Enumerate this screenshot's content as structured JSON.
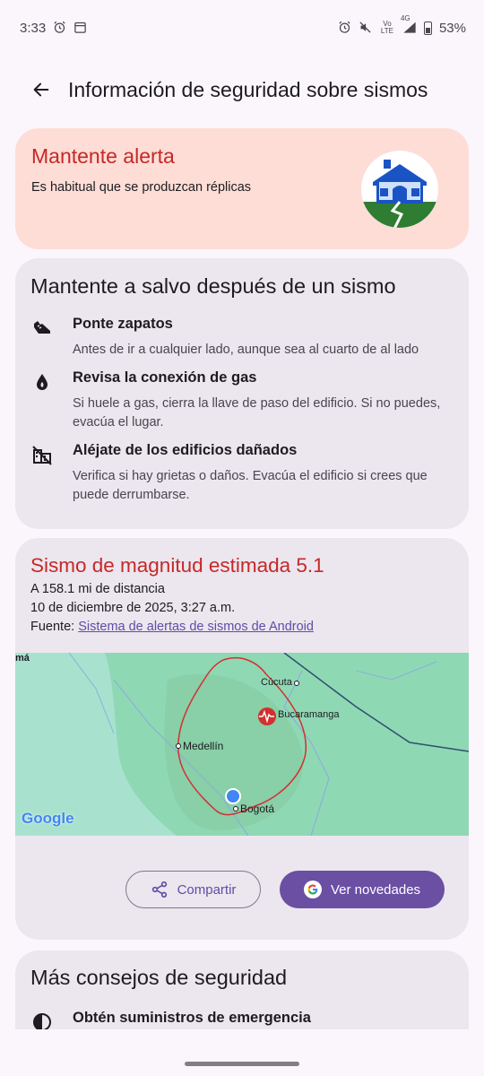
{
  "status_bar": {
    "time": "3:33",
    "network": "4G",
    "volte": "Vo LTE",
    "battery": "53%"
  },
  "app_bar": {
    "title": "Información de seguridad sobre sismos"
  },
  "alert_card": {
    "title": "Mantente alerta",
    "subtitle": "Es habitual que se produzcan réplicas"
  },
  "safety_card": {
    "heading": "Mantente a salvo después de un sismo",
    "tips": [
      {
        "icon": "shoe-icon",
        "title": "Ponte zapatos",
        "text": "Antes de ir a cualquier lado, aunque sea al cuarto de al lado"
      },
      {
        "icon": "gas-drop-icon",
        "title": "Revisa la conexión de gas",
        "text": "Si huele a gas, cierra la llave de paso del edificio. Si no puedes, evacúa el lugar."
      },
      {
        "icon": "damaged-building-icon",
        "title": "Aléjate de los edificios dañados",
        "text": "Verifica si hay grietas o daños. Evacúa el edificio si crees que puede derrumbarse."
      }
    ]
  },
  "quake_card": {
    "title": "Sismo de magnitud estimada 5.1",
    "distance": "A 158.1 mi de distancia",
    "datetime": "10 de diciembre de 2025, 3:27 a.m.",
    "source_label": "Fuente:",
    "source_link": "Sistema de alertas de sismos de Android",
    "map": {
      "labels": [
        "Cúcuta",
        "Bucaramanga",
        "Medellín",
        "Bogotá"
      ],
      "edge_label": "má",
      "google_logo": "Google"
    },
    "share_button": "Compartir",
    "news_button": "Ver novedades"
  },
  "more_card": {
    "heading": "Más consejos de seguridad",
    "first_tip": "Obtén suministros de emergencia"
  },
  "colors": {
    "alert_red": "#c62828",
    "alert_bg": "#fdddd6",
    "card_bg": "#ece6ee",
    "accent_purple": "#6a4fa3",
    "map_water": "#a8e2cf"
  }
}
